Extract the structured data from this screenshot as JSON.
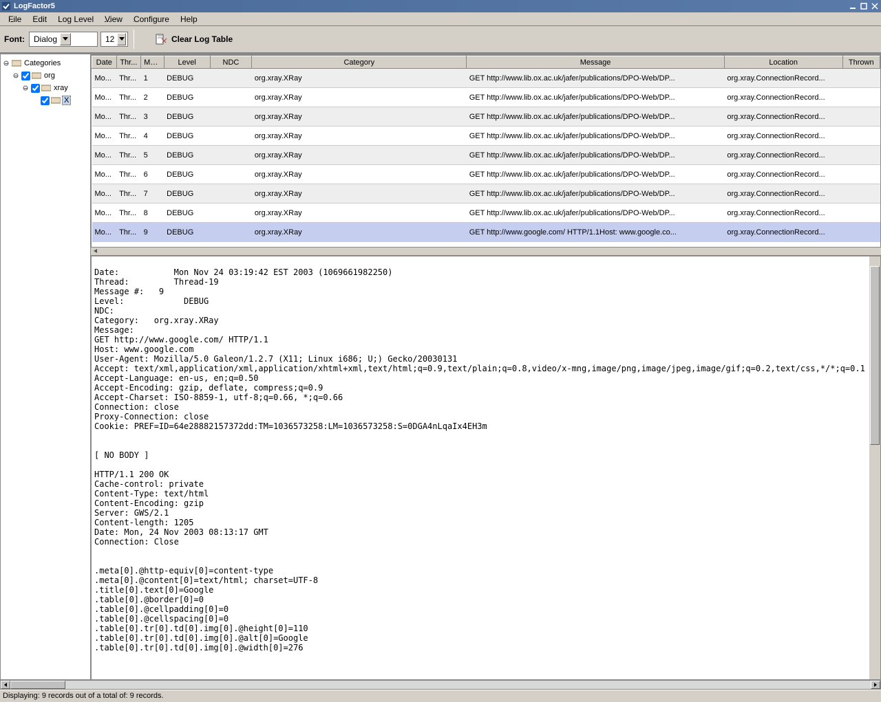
{
  "window": {
    "title": "LogFactor5"
  },
  "menubar": [
    "File",
    "Edit",
    "Log Level",
    "View",
    "Configure",
    "Help"
  ],
  "toolbar": {
    "font_label": "Font:",
    "font_value": "Dialog",
    "size_value": "12",
    "clear_label": "Clear Log Table"
  },
  "tree": {
    "root": "Categories",
    "n1": "org",
    "n2": "xray",
    "n3": "X"
  },
  "columns": [
    "Date",
    "Thr...",
    "Mes...",
    "Level",
    "NDC",
    "Category",
    "Message",
    "Location",
    "Thrown"
  ],
  "rows": [
    {
      "date": "Mo...",
      "thread": "Thr...",
      "msg": "1",
      "level": "DEBUG",
      "ndc": "",
      "category": "org.xray.XRay",
      "message": "GET http://www.lib.ox.ac.uk/jafer/publications/DPO-Web/DP...",
      "location": "org.xray.ConnectionRecord...",
      "thrown": ""
    },
    {
      "date": "Mo...",
      "thread": "Thr...",
      "msg": "2",
      "level": "DEBUG",
      "ndc": "",
      "category": "org.xray.XRay",
      "message": "GET http://www.lib.ox.ac.uk/jafer/publications/DPO-Web/DP...",
      "location": "org.xray.ConnectionRecord...",
      "thrown": ""
    },
    {
      "date": "Mo...",
      "thread": "Thr...",
      "msg": "3",
      "level": "DEBUG",
      "ndc": "",
      "category": "org.xray.XRay",
      "message": "GET http://www.lib.ox.ac.uk/jafer/publications/DPO-Web/DP...",
      "location": "org.xray.ConnectionRecord...",
      "thrown": ""
    },
    {
      "date": "Mo...",
      "thread": "Thr...",
      "msg": "4",
      "level": "DEBUG",
      "ndc": "",
      "category": "org.xray.XRay",
      "message": "GET http://www.lib.ox.ac.uk/jafer/publications/DPO-Web/DP...",
      "location": "org.xray.ConnectionRecord...",
      "thrown": ""
    },
    {
      "date": "Mo...",
      "thread": "Thr...",
      "msg": "5",
      "level": "DEBUG",
      "ndc": "",
      "category": "org.xray.XRay",
      "message": "GET http://www.lib.ox.ac.uk/jafer/publications/DPO-Web/DP...",
      "location": "org.xray.ConnectionRecord...",
      "thrown": ""
    },
    {
      "date": "Mo...",
      "thread": "Thr...",
      "msg": "6",
      "level": "DEBUG",
      "ndc": "",
      "category": "org.xray.XRay",
      "message": "GET http://www.lib.ox.ac.uk/jafer/publications/DPO-Web/DP...",
      "location": "org.xray.ConnectionRecord...",
      "thrown": ""
    },
    {
      "date": "Mo...",
      "thread": "Thr...",
      "msg": "7",
      "level": "DEBUG",
      "ndc": "",
      "category": "org.xray.XRay",
      "message": "GET http://www.lib.ox.ac.uk/jafer/publications/DPO-Web/DP...",
      "location": "org.xray.ConnectionRecord...",
      "thrown": ""
    },
    {
      "date": "Mo...",
      "thread": "Thr...",
      "msg": "8",
      "level": "DEBUG",
      "ndc": "",
      "category": "org.xray.XRay",
      "message": "GET http://www.lib.ox.ac.uk/jafer/publications/DPO-Web/DP...",
      "location": "org.xray.ConnectionRecord...",
      "thrown": ""
    },
    {
      "date": "Mo...",
      "thread": "Thr...",
      "msg": "9",
      "level": "DEBUG",
      "ndc": "",
      "category": "org.xray.XRay",
      "message": "GET http://www.google.com/ HTTP/1.1Host: www.google.co...",
      "location": "org.xray.ConnectionRecord...",
      "thrown": ""
    }
  ],
  "selected_row": 8,
  "detail": "Date:           Mon Nov 24 03:19:42 EST 2003 (1069661982250)\nThread:         Thread-19\nMessage #:   9\nLevel:            DEBUG\nNDC:\nCategory:   org.xray.XRay\nMessage:\nGET http://www.google.com/ HTTP/1.1\nHost: www.google.com\nUser-Agent: Mozilla/5.0 Galeon/1.2.7 (X11; Linux i686; U;) Gecko/20030131\nAccept: text/xml,application/xml,application/xhtml+xml,text/html;q=0.9,text/plain;q=0.8,video/x-mng,image/png,image/jpeg,image/gif;q=0.2,text/css,*/*;q=0.1\nAccept-Language: en-us, en;q=0.50\nAccept-Encoding: gzip, deflate, compress;q=0.9\nAccept-Charset: ISO-8859-1, utf-8;q=0.66, *;q=0.66\nConnection: close\nProxy-Connection: close\nCookie: PREF=ID=64e28882157372dd:TM=1036573258:LM=1036573258:S=0DGA4nLqaIx4EH3m\n\n\n[ NO BODY ]\n\nHTTP/1.1 200 OK\nCache-control: private\nContent-Type: text/html\nContent-Encoding: gzip\nServer: GWS/2.1\nContent-length: 1205\nDate: Mon, 24 Nov 2003 08:13:17 GMT\nConnection: Close\n\n\n.meta[0].@http-equiv[0]=content-type\n.meta[0].@content[0]=text/html; charset=UTF-8\n.title[0].text[0]=Google\n.table[0].@border[0]=0\n.table[0].@cellpadding[0]=0\n.table[0].@cellspacing[0]=0\n.table[0].tr[0].td[0].img[0].@height[0]=110\n.table[0].tr[0].td[0].img[0].@alt[0]=Google\n.table[0].tr[0].td[0].img[0].@width[0]=276",
  "status": "Displaying: 9 records out of a total of: 9 records."
}
